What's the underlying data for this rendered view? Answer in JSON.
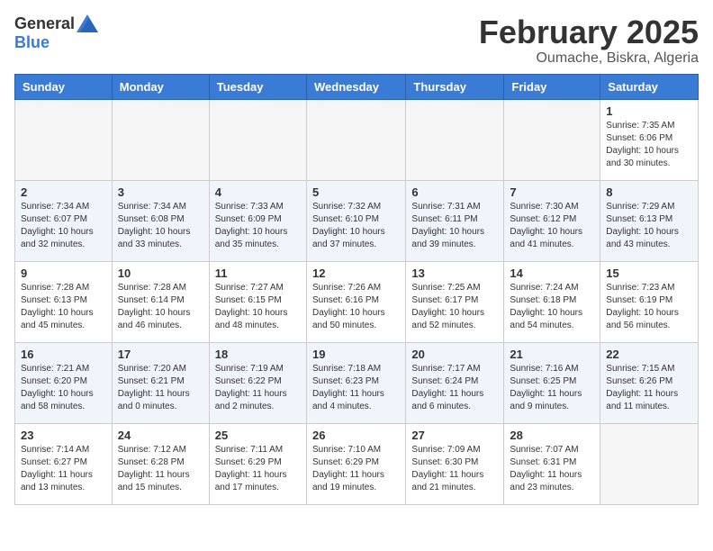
{
  "header": {
    "logo_general": "General",
    "logo_blue": "Blue",
    "month_year": "February 2025",
    "location": "Oumache, Biskra, Algeria"
  },
  "days_of_week": [
    "Sunday",
    "Monday",
    "Tuesday",
    "Wednesday",
    "Thursday",
    "Friday",
    "Saturday"
  ],
  "weeks": [
    [
      {
        "day": "",
        "info": ""
      },
      {
        "day": "",
        "info": ""
      },
      {
        "day": "",
        "info": ""
      },
      {
        "day": "",
        "info": ""
      },
      {
        "day": "",
        "info": ""
      },
      {
        "day": "",
        "info": ""
      },
      {
        "day": "1",
        "info": "Sunrise: 7:35 AM\nSunset: 6:06 PM\nDaylight: 10 hours and 30 minutes."
      }
    ],
    [
      {
        "day": "2",
        "info": "Sunrise: 7:34 AM\nSunset: 6:07 PM\nDaylight: 10 hours and 32 minutes."
      },
      {
        "day": "3",
        "info": "Sunrise: 7:34 AM\nSunset: 6:08 PM\nDaylight: 10 hours and 33 minutes."
      },
      {
        "day": "4",
        "info": "Sunrise: 7:33 AM\nSunset: 6:09 PM\nDaylight: 10 hours and 35 minutes."
      },
      {
        "day": "5",
        "info": "Sunrise: 7:32 AM\nSunset: 6:10 PM\nDaylight: 10 hours and 37 minutes."
      },
      {
        "day": "6",
        "info": "Sunrise: 7:31 AM\nSunset: 6:11 PM\nDaylight: 10 hours and 39 minutes."
      },
      {
        "day": "7",
        "info": "Sunrise: 7:30 AM\nSunset: 6:12 PM\nDaylight: 10 hours and 41 minutes."
      },
      {
        "day": "8",
        "info": "Sunrise: 7:29 AM\nSunset: 6:13 PM\nDaylight: 10 hours and 43 minutes."
      }
    ],
    [
      {
        "day": "9",
        "info": "Sunrise: 7:28 AM\nSunset: 6:13 PM\nDaylight: 10 hours and 45 minutes."
      },
      {
        "day": "10",
        "info": "Sunrise: 7:28 AM\nSunset: 6:14 PM\nDaylight: 10 hours and 46 minutes."
      },
      {
        "day": "11",
        "info": "Sunrise: 7:27 AM\nSunset: 6:15 PM\nDaylight: 10 hours and 48 minutes."
      },
      {
        "day": "12",
        "info": "Sunrise: 7:26 AM\nSunset: 6:16 PM\nDaylight: 10 hours and 50 minutes."
      },
      {
        "day": "13",
        "info": "Sunrise: 7:25 AM\nSunset: 6:17 PM\nDaylight: 10 hours and 52 minutes."
      },
      {
        "day": "14",
        "info": "Sunrise: 7:24 AM\nSunset: 6:18 PM\nDaylight: 10 hours and 54 minutes."
      },
      {
        "day": "15",
        "info": "Sunrise: 7:23 AM\nSunset: 6:19 PM\nDaylight: 10 hours and 56 minutes."
      }
    ],
    [
      {
        "day": "16",
        "info": "Sunrise: 7:21 AM\nSunset: 6:20 PM\nDaylight: 10 hours and 58 minutes."
      },
      {
        "day": "17",
        "info": "Sunrise: 7:20 AM\nSunset: 6:21 PM\nDaylight: 11 hours and 0 minutes."
      },
      {
        "day": "18",
        "info": "Sunrise: 7:19 AM\nSunset: 6:22 PM\nDaylight: 11 hours and 2 minutes."
      },
      {
        "day": "19",
        "info": "Sunrise: 7:18 AM\nSunset: 6:23 PM\nDaylight: 11 hours and 4 minutes."
      },
      {
        "day": "20",
        "info": "Sunrise: 7:17 AM\nSunset: 6:24 PM\nDaylight: 11 hours and 6 minutes."
      },
      {
        "day": "21",
        "info": "Sunrise: 7:16 AM\nSunset: 6:25 PM\nDaylight: 11 hours and 9 minutes."
      },
      {
        "day": "22",
        "info": "Sunrise: 7:15 AM\nSunset: 6:26 PM\nDaylight: 11 hours and 11 minutes."
      }
    ],
    [
      {
        "day": "23",
        "info": "Sunrise: 7:14 AM\nSunset: 6:27 PM\nDaylight: 11 hours and 13 minutes."
      },
      {
        "day": "24",
        "info": "Sunrise: 7:12 AM\nSunset: 6:28 PM\nDaylight: 11 hours and 15 minutes."
      },
      {
        "day": "25",
        "info": "Sunrise: 7:11 AM\nSunset: 6:29 PM\nDaylight: 11 hours and 17 minutes."
      },
      {
        "day": "26",
        "info": "Sunrise: 7:10 AM\nSunset: 6:29 PM\nDaylight: 11 hours and 19 minutes."
      },
      {
        "day": "27",
        "info": "Sunrise: 7:09 AM\nSunset: 6:30 PM\nDaylight: 11 hours and 21 minutes."
      },
      {
        "day": "28",
        "info": "Sunrise: 7:07 AM\nSunset: 6:31 PM\nDaylight: 11 hours and 23 minutes."
      },
      {
        "day": "",
        "info": ""
      }
    ]
  ]
}
